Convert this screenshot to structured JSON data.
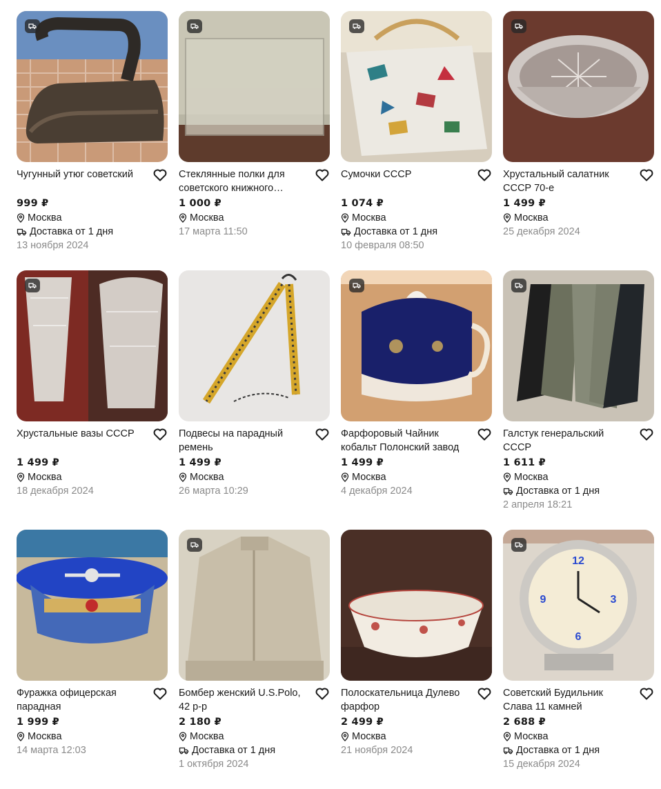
{
  "cards": [
    {
      "title": "Чугунный утюг советский",
      "price": "999 ₽",
      "location": "Москва",
      "delivery": "Доставка от 1 дня",
      "date": "13 ноября 2024",
      "has_delivery_chip": true,
      "image": "cast-iron-iron"
    },
    {
      "title": "Стеклянные полки для советского книжного шкафа",
      "price": "1 000 ₽",
      "location": "Москва",
      "delivery": "",
      "date": "17 марта 11:50",
      "has_delivery_chip": true,
      "image": "glass-shelf"
    },
    {
      "title": "Сумочки СССР",
      "price": "1 074 ₽",
      "location": "Москва",
      "delivery": "Доставка от 1 дня",
      "date": "10 февраля 08:50",
      "has_delivery_chip": true,
      "image": "handbag"
    },
    {
      "title": "Хрустальный салатник СССР 70-е",
      "price": "1 499 ₽",
      "location": "Москва",
      "delivery": "",
      "date": "25 декабря 2024",
      "has_delivery_chip": true,
      "image": "crystal-bowl"
    },
    {
      "title": "Хрустальные вазы СССР",
      "price": "1 499 ₽",
      "location": "Москва",
      "delivery": "",
      "date": "18 декабря 2024",
      "has_delivery_chip": true,
      "image": "crystal-vases"
    },
    {
      "title": "Подвесы на парадный ремень",
      "price": "1 499 ₽",
      "location": "Москва",
      "delivery": "",
      "date": "26 марта 10:29",
      "has_delivery_chip": false,
      "image": "belt-straps"
    },
    {
      "title": "Фарфоровый Чайник кобальт Полонский завод",
      "price": "1 499 ₽",
      "location": "Москва",
      "delivery": "",
      "date": "4 декабря 2024",
      "has_delivery_chip": true,
      "image": "cobalt-teapot"
    },
    {
      "title": "Галстук генеральский СССР",
      "price": "1 611 ₽",
      "location": "Москва",
      "delivery": "Доставка от 1 дня",
      "date": "2 апреля 18:21",
      "has_delivery_chip": true,
      "image": "ties"
    },
    {
      "title": "Фуражка офицерская парадная",
      "price": "1 999 ₽",
      "location": "Москва",
      "delivery": "",
      "date": "14 марта 12:03",
      "has_delivery_chip": false,
      "image": "officer-cap"
    },
    {
      "title": "Бомбер женский U.S.Polo, 42 р-р",
      "price": "2 180 ₽",
      "location": "Москва",
      "delivery": "Доставка от 1 дня",
      "date": "1 октября 2024",
      "has_delivery_chip": true,
      "image": "bomber-jacket"
    },
    {
      "title": "Полоскательница Дулево фарфор",
      "price": "2 499 ₽",
      "location": "Москва",
      "delivery": "",
      "date": "21 ноября 2024",
      "has_delivery_chip": false,
      "image": "porcelain-bowl"
    },
    {
      "title": "Советский Будильник Слава 11 камней",
      "price": "2 688 ₽",
      "location": "Москва",
      "delivery": "Доставка от 1 дня",
      "date": "15 декабря 2024",
      "has_delivery_chip": true,
      "image": "alarm-clock"
    }
  ]
}
